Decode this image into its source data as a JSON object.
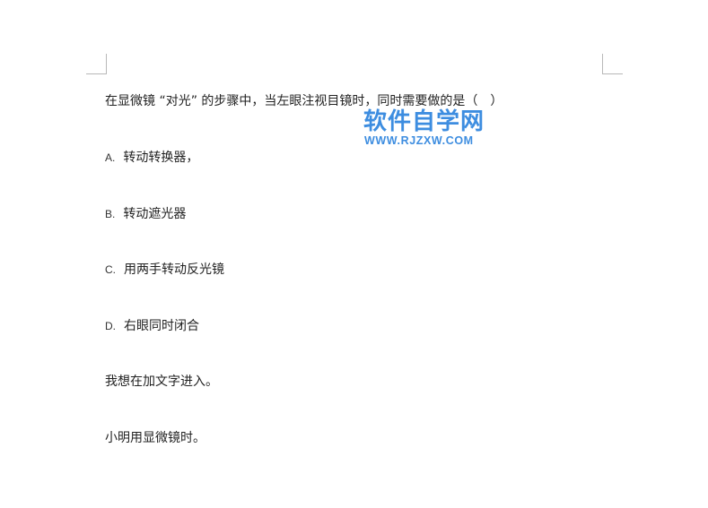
{
  "document": {
    "question": "在显微镜 “对光” 的步骤中，当左眼注视目镜时，同时需要做的是（　）",
    "options": [
      {
        "letter": "A.",
        "text": "转动转换器，"
      },
      {
        "letter": "B.",
        "text": "转动遮光器"
      },
      {
        "letter": "C.",
        "text": "用两手转动反光镜"
      },
      {
        "letter": "D.",
        "text": "右眼同时闭合"
      }
    ],
    "paragraphs": [
      "我想在加文字进入。",
      "小明用显微镜时。"
    ]
  },
  "watermark": {
    "title": "软件自学网",
    "url": "WWW.RJZXW.COM",
    "color": "#3d8de0"
  },
  "colors": {
    "text": "#222222",
    "crop_marks": "#b8b8b8",
    "background": "#ffffff"
  }
}
